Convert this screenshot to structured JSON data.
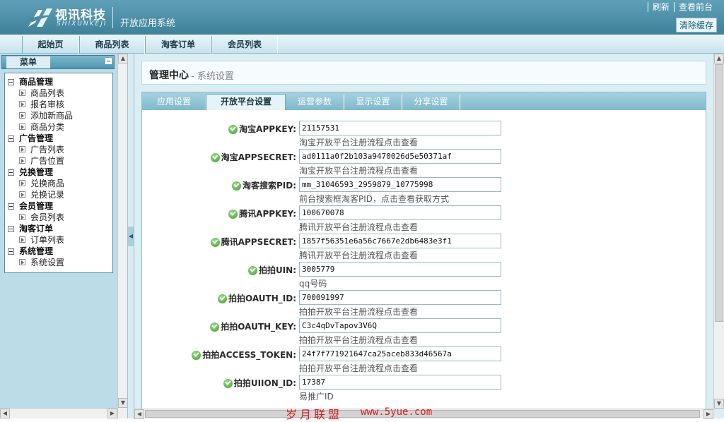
{
  "header": {
    "logo_cn": "视讯科技",
    "logo_en": "SHIXUNKEJI",
    "system_name": "开放应用系统",
    "links": [
      "刷新",
      "查看前台"
    ],
    "clear_cache": "清除缓存"
  },
  "nav": [
    "起始页",
    "商品列表",
    "淘客订单",
    "会员列表"
  ],
  "sidebar": {
    "menu_title": "菜单",
    "groups": [
      {
        "label": "商品管理",
        "items": [
          "商品列表",
          "报名审核",
          "添加新商品",
          "商品分类"
        ]
      },
      {
        "label": "广告管理",
        "items": [
          "广告列表",
          "广告位置"
        ]
      },
      {
        "label": "兑换管理",
        "items": [
          "兑换商品",
          "兑换记录"
        ]
      },
      {
        "label": "会员管理",
        "items": [
          "会员列表"
        ]
      },
      {
        "label": "淘客订单",
        "items": [
          "订单列表"
        ]
      },
      {
        "label": "系统管理",
        "items": [
          "系统设置"
        ]
      }
    ]
  },
  "breadcrumb": {
    "main": "管理中心",
    "sub": "- 系统设置"
  },
  "tabs": [
    {
      "label": "应用设置",
      "active": false
    },
    {
      "label": "开放平台设置",
      "active": true
    },
    {
      "label": "运营参数",
      "active": false
    },
    {
      "label": "显示设置",
      "active": false
    },
    {
      "label": "分享设置",
      "active": false
    }
  ],
  "fields": [
    {
      "label": "淘宝APPKEY:",
      "value": "21157531",
      "hint": "淘宝开放平台注册流程点击查看"
    },
    {
      "label": "淘宝APPSECRET:",
      "value": "ad0111a0f2b103a9470026d5e50371af",
      "hint": "淘宝开放平台注册流程点击查看"
    },
    {
      "label": "淘客搜索PID:",
      "value": "mm_31046593_2959879_10775998",
      "hint": "前台搜索框淘客PID，点击查看获取方式"
    },
    {
      "label": "腾讯APPKEY:",
      "value": "100670078",
      "hint": "腾讯开放平台注册流程点击查看"
    },
    {
      "label": "腾讯APPSECRET:",
      "value": "1857f56351e6a56c7667e2db6483e3f1",
      "hint": "腾讯开放平台注册流程点击查看"
    },
    {
      "label": "拍拍UIN:",
      "value": "3005779",
      "hint": "qq号码"
    },
    {
      "label": "拍拍OAUTH_ID:",
      "value": "700091997",
      "hint": "拍拍开放平台注册流程点击查看"
    },
    {
      "label": "拍拍OAUTH_KEY:",
      "value": "C3c4qDvTapov3V6Q",
      "hint": "拍拍开放平台注册流程点击查看"
    },
    {
      "label": "拍拍ACCESS_TOKEN:",
      "value": "24f7f771921647ca25aceb833d46567a",
      "hint": "拍拍开放平台注册流程点击查看"
    },
    {
      "label": "拍拍UIION_ID:",
      "value": "17387",
      "hint": "易推广ID"
    }
  ],
  "watermark": {
    "text": "岁月联盟",
    "url": "www.5yue.com"
  },
  "colors": {
    "header": "#4a8da6",
    "accent": "#8cbfd0",
    "ok": "#3d9a2b",
    "watermark": "#d02020"
  }
}
